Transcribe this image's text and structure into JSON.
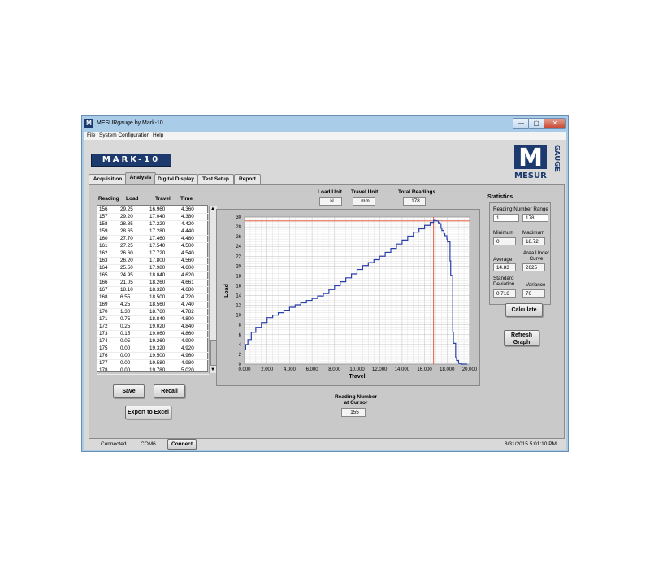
{
  "window": {
    "title": "MESURgauge by Mark-10",
    "icon_letter": "M",
    "minimize_glyph": "—",
    "maximize_glyph": "▢",
    "close_glyph": "✕"
  },
  "menu": [
    "File",
    "System Configuration",
    "Help"
  ],
  "logos": {
    "mark10": "MARK-10",
    "mesur": "MESUR",
    "gauge": "GAUGE",
    "m": "M"
  },
  "tabs": [
    {
      "label": "Acquisition",
      "active": false
    },
    {
      "label": "Analysis",
      "active": true
    },
    {
      "label": "Digital Display",
      "active": false
    },
    {
      "label": "Test Setup",
      "active": false
    },
    {
      "label": "Report",
      "active": false
    }
  ],
  "table": {
    "headers": [
      "Reading",
      "Load",
      "Travel",
      "Time"
    ],
    "rows": [
      [
        "156",
        "29.25",
        "16.960",
        "4.360"
      ],
      [
        "157",
        "29.20",
        "17.040",
        "4.380"
      ],
      [
        "158",
        "28.85",
        "17.220",
        "4.420"
      ],
      [
        "159",
        "28.65",
        "17.280",
        "4.440"
      ],
      [
        "160",
        "27.70",
        "17.460",
        "4.480"
      ],
      [
        "161",
        "27.25",
        "17.540",
        "4.500"
      ],
      [
        "162",
        "26.60",
        "17.720",
        "4.540"
      ],
      [
        "163",
        "26.20",
        "17.800",
        "4.560"
      ],
      [
        "164",
        "25.50",
        "17.980",
        "4.600"
      ],
      [
        "165",
        "24.95",
        "18.040",
        "4.620"
      ],
      [
        "166",
        "21.05",
        "18.260",
        "4.661"
      ],
      [
        "167",
        "18.10",
        "18.320",
        "4.680"
      ],
      [
        "168",
        "6.55",
        "18.500",
        "4.720"
      ],
      [
        "169",
        "4.25",
        "18.560",
        "4.740"
      ],
      [
        "170",
        "1.30",
        "18.760",
        "4.782"
      ],
      [
        "171",
        "0.75",
        "18.840",
        "4.800"
      ],
      [
        "172",
        "0.25",
        "19.020",
        "4.840"
      ],
      [
        "173",
        "0.15",
        "19.060",
        "4.860"
      ],
      [
        "174",
        "0.05",
        "19.260",
        "4.900"
      ],
      [
        "175",
        "0.00",
        "19.320",
        "4.920"
      ],
      [
        "176",
        "0.00",
        "19.500",
        "4.960"
      ],
      [
        "177",
        "0.00",
        "19.580",
        "4.980"
      ],
      [
        "178",
        "0.00",
        "19.780",
        "5.020"
      ]
    ],
    "scroll_up": "▲",
    "scroll_down": "▼"
  },
  "buttons": {
    "save": "Save",
    "recall": "Recall",
    "export": "Export to Excel",
    "calculate": "Calculate",
    "refresh": "Refresh Graph",
    "connect": "Connect"
  },
  "units": {
    "load_unit_label": "Load Unit",
    "load_unit": "N",
    "travel_unit_label": "Travel Unit",
    "travel_unit": "mm",
    "total_readings_label": "Total Readings",
    "total_readings": "178"
  },
  "cursor": {
    "label": "Reading Number at Cursor",
    "value": "155"
  },
  "statistics": {
    "title": "Statistics",
    "range_label": "Reading Number Range",
    "range_from": "1",
    "range_to": "178",
    "minimum_label": "Minimum",
    "minimum": "0",
    "maximum_label": "Maximum",
    "maximum": "18.72",
    "average_label": "Average",
    "average": "14.83",
    "area_label": "Area Under Curve",
    "area": "2625",
    "stddev_label": "Standard Deviation",
    "stddev": "0.716",
    "variance_label": "Variance",
    "variance": "76"
  },
  "status": {
    "connection": "Connected",
    "port": "COM6",
    "datetime": "8/31/2015 5:01:10 PM"
  },
  "chart_data": {
    "type": "line",
    "xlabel": "Travel",
    "ylabel": "Load",
    "xlim": [
      0,
      20
    ],
    "ylim": [
      0,
      30
    ],
    "x_ticks": [
      "0.000",
      "2.000",
      "4.000",
      "6.000",
      "8.000",
      "10.000",
      "12.000",
      "14.000",
      "16.000",
      "18.000",
      "20.000"
    ],
    "y_ticks": [
      "0",
      "2",
      "4",
      "6",
      "8",
      "10",
      "12",
      "14",
      "16",
      "18",
      "20",
      "22",
      "24",
      "26",
      "28",
      "30"
    ],
    "grid": true,
    "line_color": "#2a3fa8",
    "cursor_color": "#e04a2a",
    "cursor_x": 16.8,
    "cursor_y": 29.2,
    "series": [
      {
        "x": [
          0,
          0.1,
          0.3,
          0.6,
          1.0,
          1.5,
          2.0,
          2.5,
          3.0,
          3.5,
          4.0,
          4.5,
          5.0,
          5.5,
          6.0,
          6.5,
          7.0,
          7.5,
          8.0,
          8.5,
          9.0,
          9.5,
          10.0,
          10.5,
          11.0,
          11.5,
          12.0,
          12.5,
          13.0,
          13.5,
          14.0,
          14.5,
          15.0,
          15.5,
          16.0,
          16.5,
          16.8,
          16.96,
          17.04,
          17.22,
          17.28,
          17.46,
          17.54,
          17.72,
          17.8,
          17.98,
          18.04,
          18.26,
          18.32,
          18.5,
          18.56,
          18.76,
          18.84,
          19.02,
          19.06,
          19.26,
          19.32,
          19.5,
          19.78
        ],
        "y": [
          3.0,
          4.0,
          5.0,
          6.5,
          7.5,
          8.5,
          9.5,
          10.0,
          10.5,
          11.0,
          11.6,
          12.1,
          12.5,
          13.0,
          13.4,
          13.9,
          14.4,
          15.2,
          16.0,
          16.8,
          17.6,
          18.4,
          19.3,
          20.1,
          20.7,
          21.3,
          22.0,
          22.8,
          23.6,
          24.5,
          25.3,
          26.1,
          26.9,
          27.6,
          28.3,
          28.9,
          29.3,
          29.25,
          29.2,
          28.85,
          28.65,
          27.7,
          27.25,
          26.6,
          26.2,
          25.5,
          24.95,
          21.05,
          18.1,
          6.55,
          4.25,
          1.3,
          0.75,
          0.25,
          0.15,
          0.05,
          0.0,
          0.0,
          0.0
        ]
      }
    ]
  }
}
